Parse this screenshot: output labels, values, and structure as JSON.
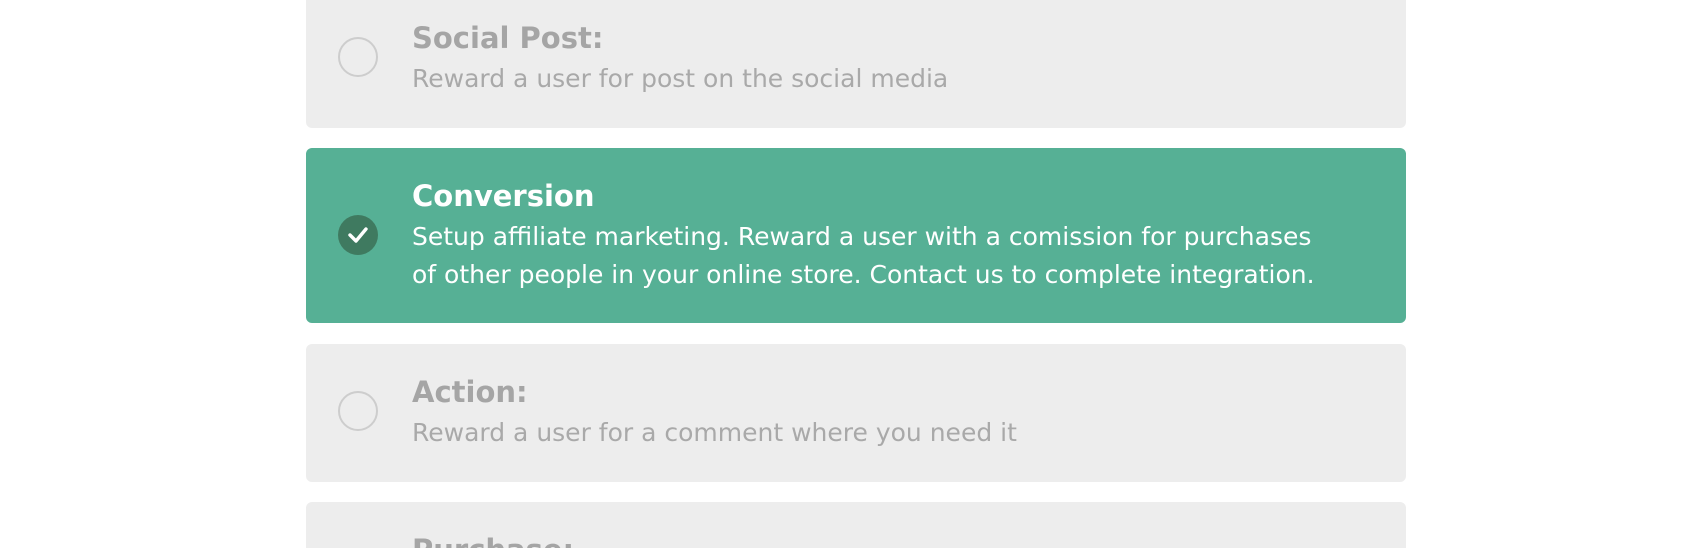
{
  "options": [
    {
      "title": "Social Post:",
      "description": "Reward a user for post on the social media",
      "selected": false
    },
    {
      "title": "Conversion",
      "description": "Setup affiliate marketing. Reward a user with a comission for purchases of other people in your online store. Contact us to complete integration.",
      "selected": true
    },
    {
      "title": "Action:",
      "description": "Reward a user for a comment where you need it",
      "selected": false
    },
    {
      "title": "Purchase:",
      "description": "",
      "selected": false
    }
  ],
  "colors": {
    "selected_bg": "#56b095",
    "unselected_bg": "#ededed",
    "check_circle": "#3f7a60"
  },
  "icons": {
    "selected": "check-icon",
    "unselected": "radio-empty-icon"
  }
}
